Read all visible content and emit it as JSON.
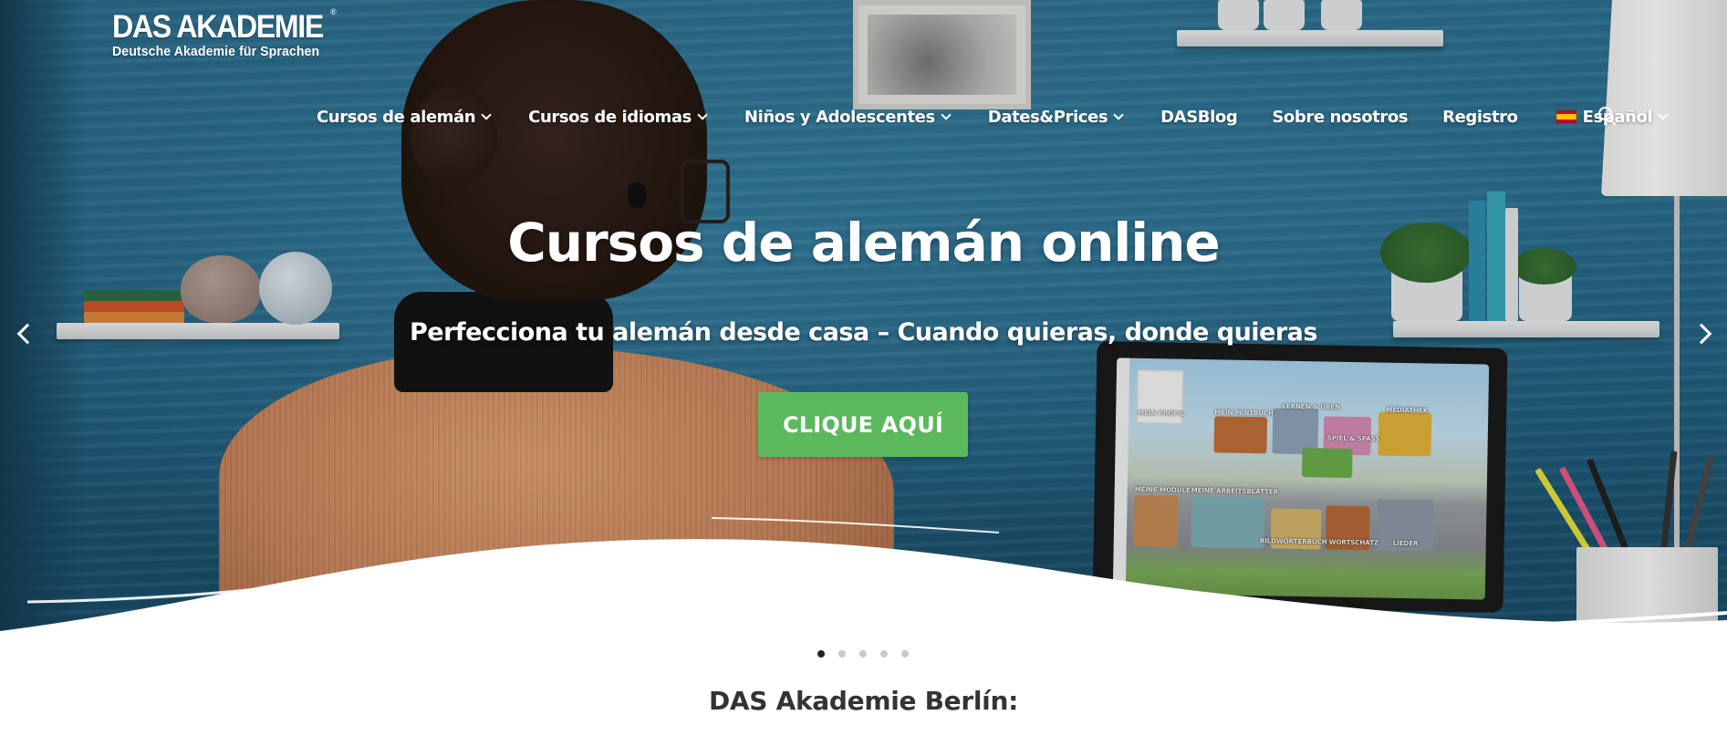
{
  "brand": {
    "title": "DAS AKADEMIE",
    "subtitle": "Deutsche Akademie für Sprachen",
    "registered": "®"
  },
  "nav": {
    "items": [
      {
        "label": "Cursos de alemán",
        "has_dropdown": true
      },
      {
        "label": "Cursos de idiomas",
        "has_dropdown": true
      },
      {
        "label": "Niños y Adolescentes",
        "has_dropdown": true
      },
      {
        "label": "Dates&Prices",
        "has_dropdown": true
      },
      {
        "label": "DASBlog",
        "has_dropdown": false
      },
      {
        "label": "Sobre nosotros",
        "has_dropdown": false
      },
      {
        "label": "Registro",
        "has_dropdown": false
      }
    ],
    "language": {
      "label": "Español",
      "flag": "spain-flag-icon"
    },
    "search_icon": "search-icon"
  },
  "hero": {
    "title": "Cursos de alemán online",
    "subtitle": "Perfecciona tu alemán desde casa – Cuando quieras, donde quieras",
    "cta_label": "CLIQUE AQUÍ",
    "cta_color": "#5cb85c",
    "slide_count": 5,
    "active_slide": 1
  },
  "laptop_screen": {
    "labels": [
      "MEIN PROFIL",
      "MEIN MINTBUCH",
      "LERNEN & ÜBEN",
      "SPIEL & SPASS",
      "MEDIATHEK",
      "MEINE MODULE",
      "MEINE ARBEITSBLÄTTER",
      "BILDWÖRTERBUCH",
      "WORTSCHATZ",
      "LIEDER"
    ]
  },
  "section": {
    "title": "DAS Akademie Berlín:"
  }
}
